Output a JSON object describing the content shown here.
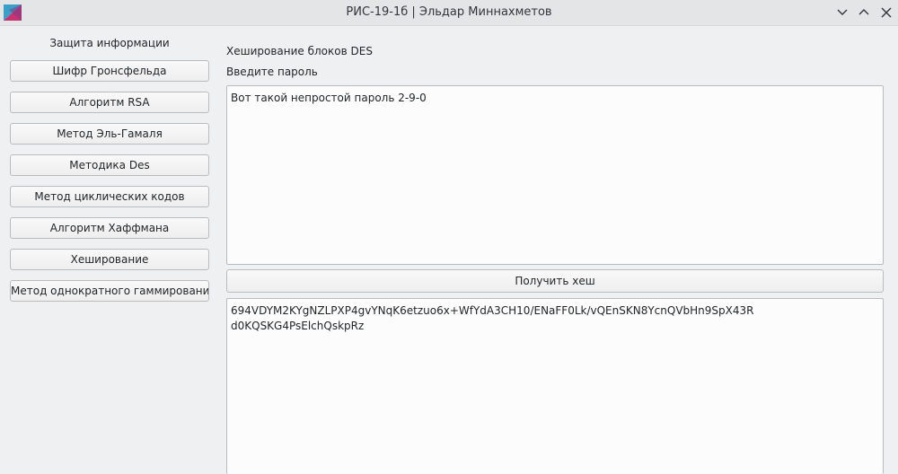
{
  "window": {
    "title": "РИС-19-1б | Эльдар Миннахметов",
    "controls": [
      "chevron-down-icon",
      "chevron-up-icon",
      "close-icon"
    ]
  },
  "sidebar": {
    "group_label": "Защита информации",
    "items": [
      {
        "label": "Шифр Гронсфельда"
      },
      {
        "label": "Алгоритм RSA"
      },
      {
        "label": "Метод Эль-Гамаля"
      },
      {
        "label": "Методика Des"
      },
      {
        "label": "Метод циклических кодов"
      },
      {
        "label": "Алгоритм Хаффмана"
      },
      {
        "label": "Хеширование"
      },
      {
        "label": "Метод однократного гаммирования"
      }
    ]
  },
  "main": {
    "section_title": "Хеширование блоков DES",
    "password_label": "Введите пароль",
    "password_value": "Вот такой непростой пароль 2-9-0",
    "hash_button_label": "Получить хеш",
    "hash_output": "694VDYM2KYgNZLPXP4gvYNqK6etzuo6x+WfYdA3CH10/ENaFF0Lk/vQEnSKN8YcnQVbHn9SpX43R\nd0KQSKG4PsElchQskpRz"
  }
}
